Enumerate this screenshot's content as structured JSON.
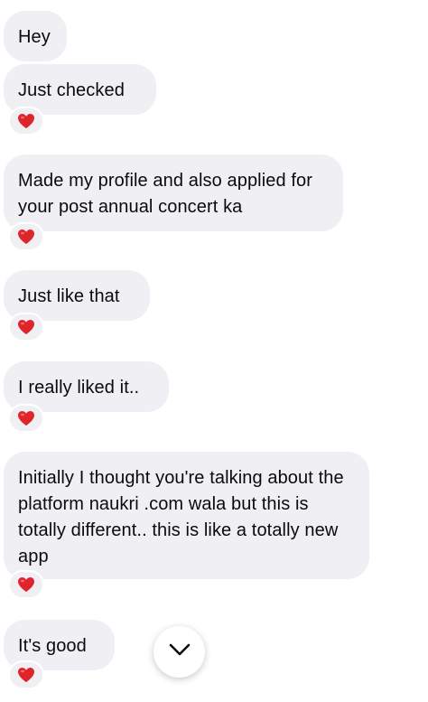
{
  "messages": [
    {
      "text": "Hey",
      "reaction": ""
    },
    {
      "text": "Just checked",
      "reaction": "heart"
    },
    {
      "text": "Made my profile and also applied for your post annual concert ka",
      "reaction": "heart"
    },
    {
      "text": "Just like that",
      "reaction": "heart"
    },
    {
      "text": "I really liked it..",
      "reaction": "heart"
    },
    {
      "text": "Initially I thought you're talking about the platform naukri .com wala but this is totally different.. this is like a totally new app",
      "reaction": "heart"
    },
    {
      "text": "It's good",
      "reaction": "heart"
    }
  ],
  "reaction_icon": "red-heart-icon",
  "scroll_button_icon": "chevron-down-icon",
  "colors": {
    "bubble": "#efeff4",
    "heart": "#e0242b",
    "text": "#0b0b0b"
  }
}
